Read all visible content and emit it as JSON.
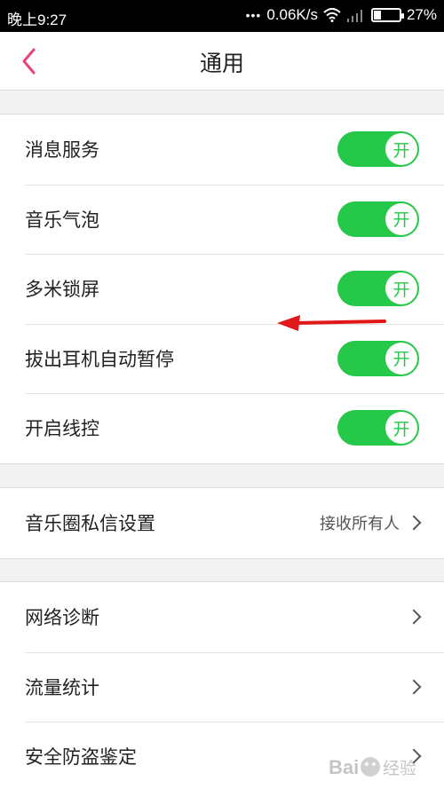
{
  "status_bar": {
    "time": "晚上9:27",
    "dots": "•••",
    "speed": "0.06K/s",
    "battery": "27%",
    "battery_level": 0.27
  },
  "header": {
    "title": "通用"
  },
  "toggles": [
    {
      "label": "消息服务",
      "state": "开"
    },
    {
      "label": "音乐气泡",
      "state": "开"
    },
    {
      "label": "多米锁屏",
      "state": "开"
    },
    {
      "label": "拔出耳机自动暂停",
      "state": "开"
    },
    {
      "label": "开启线控",
      "state": "开"
    }
  ],
  "music_circle": {
    "label": "音乐圈私信设置",
    "value": "接收所有人"
  },
  "tools": [
    {
      "label": "网络诊断"
    },
    {
      "label": "流量统计"
    },
    {
      "label": "安全防盗鉴定"
    }
  ],
  "colors": {
    "accent": "#e9437b",
    "toggle_on": "#25c848",
    "annotation_arrow": "#e01818"
  },
  "watermark": {
    "text": "Baidu经验"
  }
}
